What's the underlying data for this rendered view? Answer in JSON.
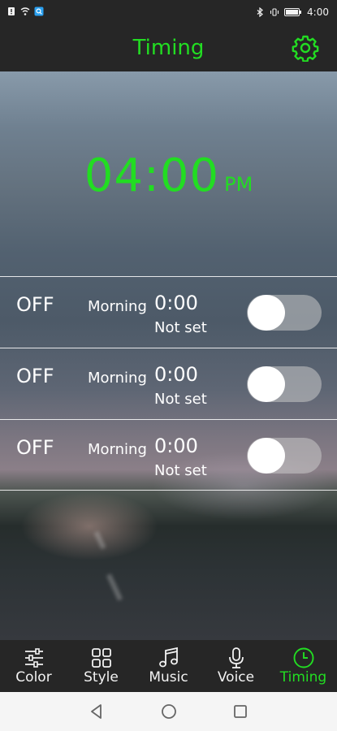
{
  "status_bar": {
    "time": "4:00",
    "left_icons": [
      "sim-alert-icon",
      "wifi-icon",
      "notification-icon"
    ],
    "right_icons": [
      "bluetooth-icon",
      "vibrate-icon",
      "battery-icon"
    ]
  },
  "header": {
    "title": "Timing",
    "settings_icon": "gear-icon"
  },
  "clock": {
    "time": "04:00",
    "ampm": "PM"
  },
  "timers": [
    {
      "state": "OFF",
      "period": "Morning",
      "time": "0:00",
      "status": "Not set",
      "enabled": false
    },
    {
      "state": "OFF",
      "period": "Morning",
      "time": "0:00",
      "status": "Not set",
      "enabled": false
    },
    {
      "state": "OFF",
      "period": "Morning",
      "time": "0:00",
      "status": "Not set",
      "enabled": false
    }
  ],
  "nav": {
    "items": [
      {
        "label": "Color",
        "icon": "sliders-icon",
        "active": false
      },
      {
        "label": "Style",
        "icon": "grid-icon",
        "active": false
      },
      {
        "label": "Music",
        "icon": "music-note-icon",
        "active": false
      },
      {
        "label": "Voice",
        "icon": "microphone-icon",
        "active": false
      },
      {
        "label": "Timing",
        "icon": "clock-icon",
        "active": true
      }
    ]
  },
  "system_bar": {
    "buttons": [
      "back-icon",
      "home-icon",
      "recents-icon"
    ]
  },
  "colors": {
    "accent": "#22dd22",
    "bar_background": "#262626",
    "toggle_track": "#c8c8c8",
    "toggle_knob": "#ffffff"
  }
}
